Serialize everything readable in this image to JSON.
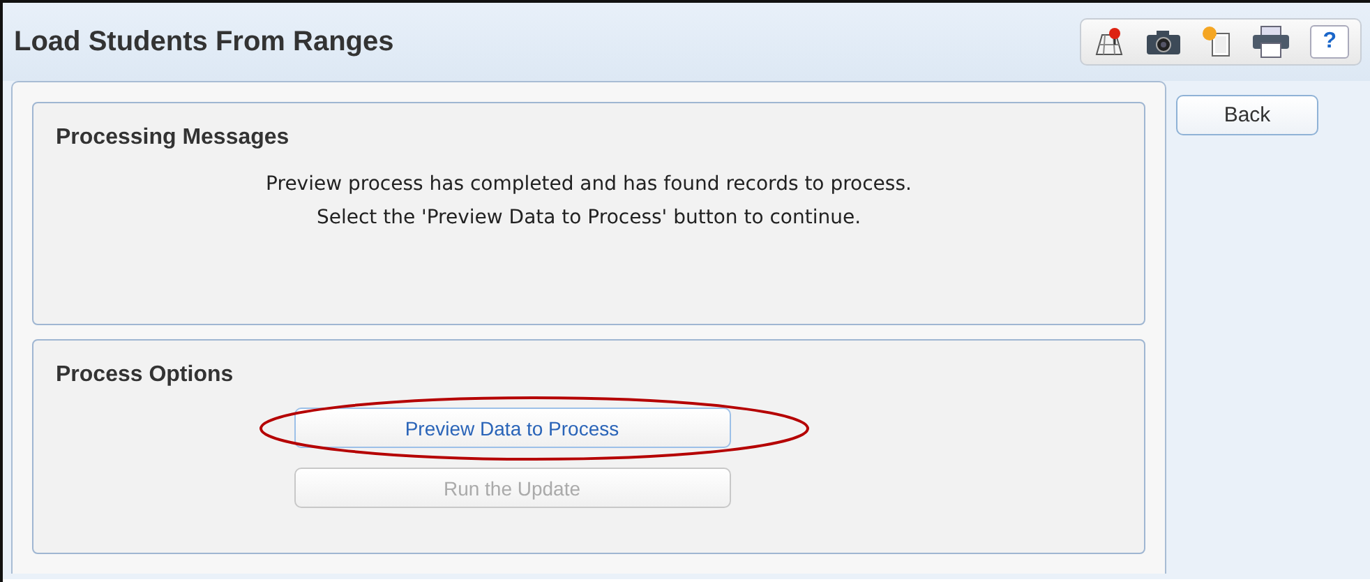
{
  "window": {
    "title": "Load Students From Ranges"
  },
  "toolbar": {
    "icons": [
      {
        "kind": "map"
      },
      {
        "kind": "camera"
      },
      {
        "kind": "copy"
      },
      {
        "kind": "print"
      }
    ],
    "help_label": "?"
  },
  "back_button": {
    "label": "Back"
  },
  "panels": [
    {
      "title": "Processing Messages",
      "lines": [
        "Preview process has completed and has found records to process.",
        "Select the 'Preview Data to Process' button to continue."
      ]
    },
    {
      "title": "Process Options",
      "buttons": [
        {
          "label": "Preview Data to Process",
          "disabled": false,
          "highlighted": true
        },
        {
          "label": "Run the Update",
          "disabled": true,
          "highlighted": false
        }
      ]
    }
  ]
}
